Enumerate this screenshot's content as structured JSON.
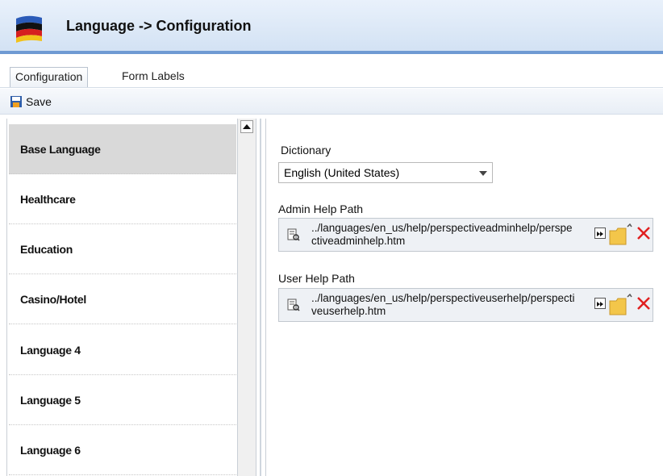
{
  "header": {
    "title": "Language -> Configuration",
    "icon": "flag-icon"
  },
  "tabs": [
    {
      "label": "Configuration",
      "active": true
    },
    {
      "label": "Form Labels",
      "active": false
    }
  ],
  "toolbar": {
    "save_label": "Save"
  },
  "languages": [
    {
      "label": "Base Language",
      "selected": true
    },
    {
      "label": "Healthcare"
    },
    {
      "label": "Education"
    },
    {
      "label": "Casino/Hotel"
    },
    {
      "label": "Language 4"
    },
    {
      "label": "Language 5"
    },
    {
      "label": "Language 6"
    }
  ],
  "form": {
    "dictionary_label": "Dictionary",
    "dictionary_value": "English (United States)",
    "admin_help_label": "Admin Help Path",
    "admin_help_value": "../languages/en_us/help/perspectiveadminhelp/perspectiveadminhelp.htm",
    "user_help_label": "User Help Path",
    "user_help_value": "../languages/en_us/help/perspectiveuserhelp/perspectiveuserhelp.htm"
  },
  "colors": {
    "accent": "#6f9ad3",
    "selected_row": "#d9d9d9",
    "delete": "#e02020"
  }
}
